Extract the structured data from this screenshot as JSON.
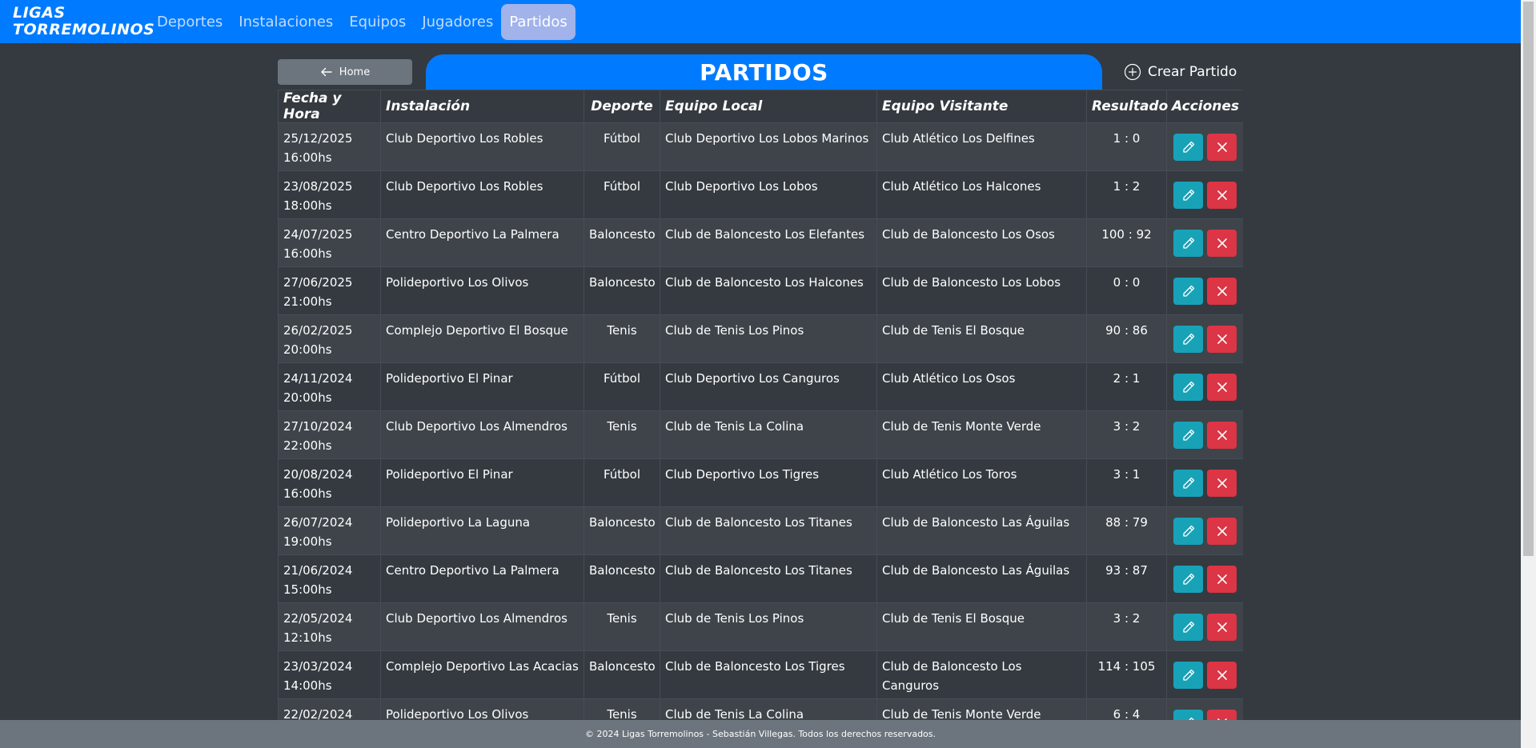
{
  "navbar": {
    "brand_line1": "LIGAS",
    "brand_line2": "TORREMOLINOS",
    "links": [
      "Deportes",
      "Instalaciones",
      "Equipos",
      "Jugadores",
      "Partidos"
    ],
    "active": "Partidos",
    "color": "#007bff"
  },
  "toolbar": {
    "home_label": "Home",
    "title": "PARTIDOS",
    "create_label": "Crear Partido"
  },
  "table": {
    "headers": [
      "Fecha y Hora",
      "Instalación",
      "Deporte",
      "Equipo Local",
      "Equipo Visitante",
      "Resultado",
      "Acciones"
    ],
    "rows": [
      {
        "fecha": "25/12/2025",
        "hora": "16:00hs",
        "instalacion": "Club Deportivo Los Robles",
        "deporte": "Fútbol",
        "local": "Club Deportivo Los Lobos Marinos",
        "visitante": "Club Atlético Los Delfines",
        "resultado": "1 : 0"
      },
      {
        "fecha": "23/08/2025",
        "hora": "18:00hs",
        "instalacion": "Club Deportivo Los Robles",
        "deporte": "Fútbol",
        "local": "Club Deportivo Los Lobos",
        "visitante": "Club Atlético Los Halcones",
        "resultado": "1 : 2"
      },
      {
        "fecha": "24/07/2025",
        "hora": "16:00hs",
        "instalacion": "Centro Deportivo La Palmera",
        "deporte": "Baloncesto",
        "local": "Club de Baloncesto Los Elefantes",
        "visitante": "Club de Baloncesto Los Osos",
        "resultado": "100 : 92"
      },
      {
        "fecha": "27/06/2025",
        "hora": "21:00hs",
        "instalacion": "Polideportivo Los Olivos",
        "deporte": "Baloncesto",
        "local": "Club de Baloncesto Los Halcones",
        "visitante": "Club de Baloncesto Los Lobos",
        "resultado": "0 : 0"
      },
      {
        "fecha": "26/02/2025",
        "hora": "20:00hs",
        "instalacion": "Complejo Deportivo El Bosque",
        "deporte": "Tenis",
        "local": "Club de Tenis Los Pinos",
        "visitante": "Club de Tenis El Bosque",
        "resultado": "90 : 86"
      },
      {
        "fecha": "24/11/2024",
        "hora": "20:00hs",
        "instalacion": "Polideportivo El Pinar",
        "deporte": "Fútbol",
        "local": "Club Deportivo Los Canguros",
        "visitante": "Club Atlético Los Osos",
        "resultado": "2 : 1"
      },
      {
        "fecha": "27/10/2024",
        "hora": "22:00hs",
        "instalacion": "Club Deportivo Los Almendros",
        "deporte": "Tenis",
        "local": "Club de Tenis La Colina",
        "visitante": "Club de Tenis Monte Verde",
        "resultado": "3 : 2"
      },
      {
        "fecha": "20/08/2024",
        "hora": "16:00hs",
        "instalacion": "Polideportivo El Pinar",
        "deporte": "Fútbol",
        "local": "Club Deportivo Los Tigres",
        "visitante": "Club Atlético Los Toros",
        "resultado": "3 : 1"
      },
      {
        "fecha": "26/07/2024",
        "hora": "19:00hs",
        "instalacion": "Polideportivo La Laguna",
        "deporte": "Baloncesto",
        "local": "Club de Baloncesto Los Titanes",
        "visitante": "Club de Baloncesto Las Águilas",
        "resultado": "88 : 79"
      },
      {
        "fecha": "21/06/2024",
        "hora": "15:00hs",
        "instalacion": "Centro Deportivo La Palmera",
        "deporte": "Baloncesto",
        "local": "Club de Baloncesto Los Titanes",
        "visitante": "Club de Baloncesto Las Águilas",
        "resultado": "93 : 87"
      },
      {
        "fecha": "22/05/2024",
        "hora": "12:10hs",
        "instalacion": "Club Deportivo Los Almendros",
        "deporte": "Tenis",
        "local": "Club de Tenis Los Pinos",
        "visitante": "Club de Tenis El Bosque",
        "resultado": "3 : 2"
      },
      {
        "fecha": "23/03/2024",
        "hora": "14:00hs",
        "instalacion": "Complejo Deportivo Las Acacias",
        "deporte": "Baloncesto",
        "local": "Club de Baloncesto Los Tigres",
        "visitante": "Club de Baloncesto Los Canguros",
        "resultado": "114 : 105"
      },
      {
        "fecha": "22/02/2024",
        "hora": "",
        "instalacion": "Polideportivo Los Olivos",
        "deporte": "Tenis",
        "local": "Club de Tenis La Colina",
        "visitante": "Club de Tenis Monte Verde",
        "resultado": "6 : 4"
      }
    ]
  },
  "icons": {
    "home": "arrow-left-icon",
    "create": "plus-circle-icon",
    "edit": "pencil-icon",
    "delete": "close-icon"
  },
  "colors": {
    "background": "#343a40",
    "primary": "#007bff",
    "edit": "#17a2b8",
    "delete": "#dc3545",
    "secondary": "#6c757d"
  },
  "footer": {
    "text": "© 2024 Ligas Torremolinos - Sebastián Villegas. Todos los derechos reservados."
  }
}
